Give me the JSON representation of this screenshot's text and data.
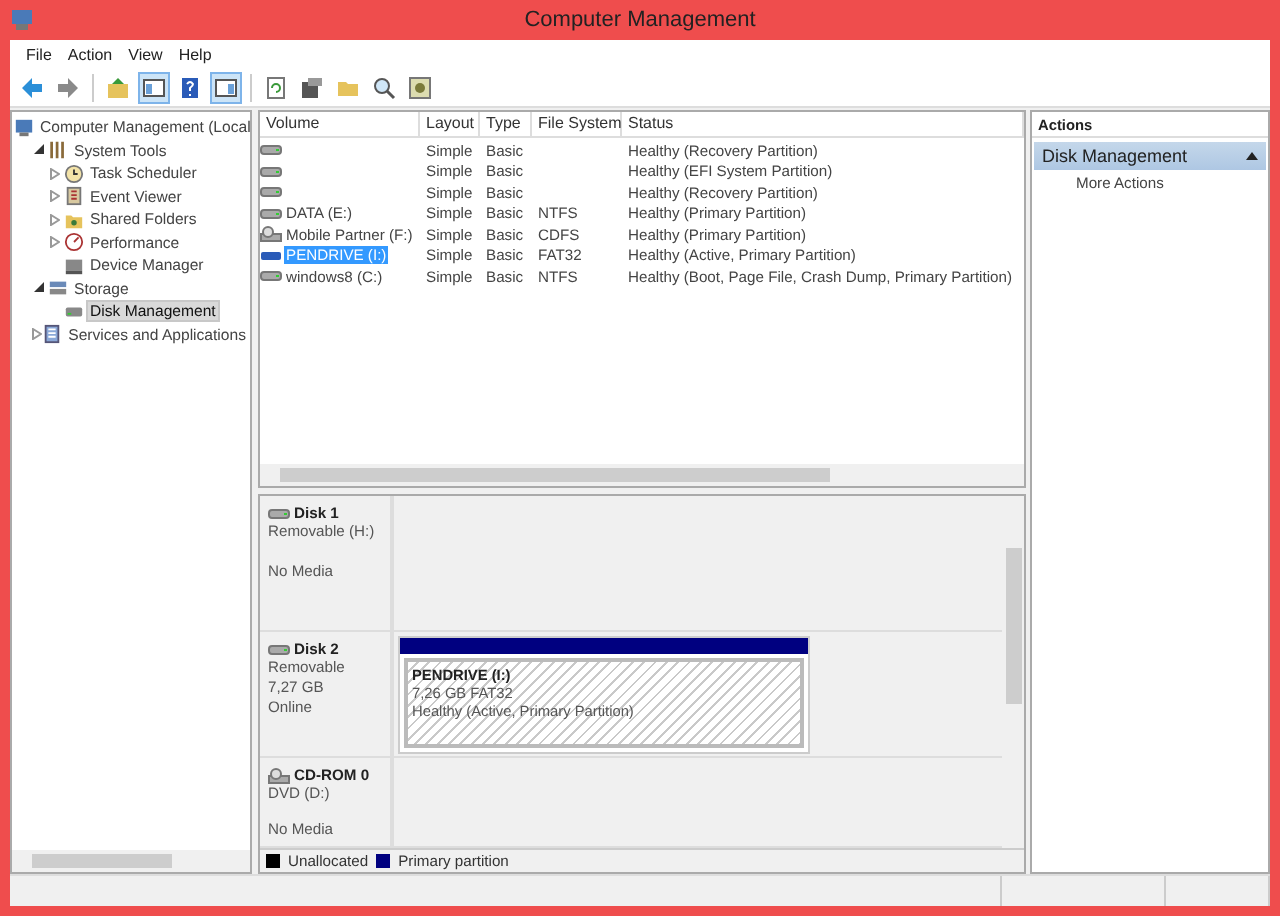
{
  "window": {
    "title": "Computer Management"
  },
  "menu": [
    "File",
    "Action",
    "View",
    "Help"
  ],
  "toolbar": [
    {
      "kind": "back",
      "pressed": false
    },
    {
      "kind": "forward",
      "pressed": false
    },
    {
      "kind": "up",
      "pressed": false
    },
    {
      "kind": "tree",
      "pressed": true
    },
    {
      "kind": "help",
      "pressed": false
    },
    {
      "kind": "pane",
      "pressed": true
    },
    {
      "kind": "refresh",
      "pressed": false
    },
    {
      "kind": "properties",
      "pressed": false
    },
    {
      "kind": "open",
      "pressed": false
    },
    {
      "kind": "search",
      "pressed": false
    },
    {
      "kind": "settings",
      "pressed": false
    }
  ],
  "tree": [
    {
      "label": "Computer Management (Local",
      "kind": "computer",
      "selected": false,
      "children": [
        {
          "label": "System Tools",
          "kind": "tools",
          "selected": false,
          "expanded": true,
          "children": [
            {
              "label": "Task Scheduler",
              "kind": "clock",
              "selected": false,
              "expanded": false
            },
            {
              "label": "Event Viewer",
              "kind": "log",
              "selected": false,
              "expanded": false
            },
            {
              "label": "Shared Folders",
              "kind": "folder",
              "selected": false,
              "expanded": false
            },
            {
              "label": "Performance",
              "kind": "gauge",
              "selected": false,
              "expanded": false
            },
            {
              "label": "Device Manager",
              "kind": "device",
              "selected": false
            }
          ]
        },
        {
          "label": "Storage",
          "kind": "storage",
          "selected": false,
          "expanded": true,
          "children": [
            {
              "label": "Disk Management",
              "kind": "disk",
              "selected": true
            }
          ]
        },
        {
          "label": "Services and Applications",
          "kind": "services",
          "selected": false,
          "expanded": false
        }
      ]
    }
  ],
  "volumes": {
    "columns": [
      "Volume",
      "Layout",
      "Type",
      "File System",
      "Status"
    ],
    "rows": [
      {
        "kind": "drive",
        "selected": false,
        "layout": "Simple",
        "type": "Basic",
        "status": "Healthy (Recovery Partition)"
      },
      {
        "kind": "drive",
        "selected": false,
        "layout": "Simple",
        "type": "Basic",
        "status": "Healthy (EFI System Partition)"
      },
      {
        "kind": "drive",
        "selected": false,
        "layout": "Simple",
        "type": "Basic",
        "status": "Healthy (Recovery Partition)"
      },
      {
        "kind": "drive",
        "selected": false,
        "volume": "DATA (E:)",
        "layout": "Simple",
        "type": "Basic",
        "file_system": "NTFS",
        "status": "Healthy (Primary Partition)"
      },
      {
        "kind": "cdrom",
        "selected": false,
        "volume": "Mobile Partner (F:)",
        "layout": "Simple",
        "type": "Basic",
        "file_system": "CDFS",
        "status": "Healthy (Primary Partition)"
      },
      {
        "kind": "usb",
        "selected": true,
        "volume": "PENDRIVE (I:)",
        "layout": "Simple",
        "type": "Basic",
        "file_system": "FAT32",
        "status": "Healthy (Active, Primary Partition)"
      },
      {
        "kind": "drive",
        "selected": false,
        "volume": "windows8 (C:)",
        "layout": "Simple",
        "type": "Basic",
        "file_system": "NTFS",
        "status": "Healthy (Boot, Page File, Crash Dump, Primary Partition)"
      }
    ]
  },
  "disks": [
    {
      "kind": "disk",
      "name": "Disk 1",
      "type": "Removable (H:)",
      "status": "No Media"
    },
    {
      "kind": "disk",
      "name": "Disk 2",
      "type": "Removable",
      "size": "7,27 GB",
      "status": "Online",
      "partition": {
        "name": "PENDRIVE  (I:)",
        "size": "7,26 GB FAT32",
        "status": "Healthy (Active, Primary Partition)"
      }
    },
    {
      "kind": "cdrom",
      "name": "CD-ROM 0",
      "type": "DVD (D:)",
      "status": "No Media"
    }
  ],
  "legend": [
    {
      "label": "Unallocated",
      "color": "#000000"
    },
    {
      "label": "Primary partition",
      "color": "#000080"
    }
  ],
  "actions": {
    "title": "Actions",
    "section": "Disk Management",
    "expanded": true,
    "items": [
      "More Actions"
    ]
  }
}
